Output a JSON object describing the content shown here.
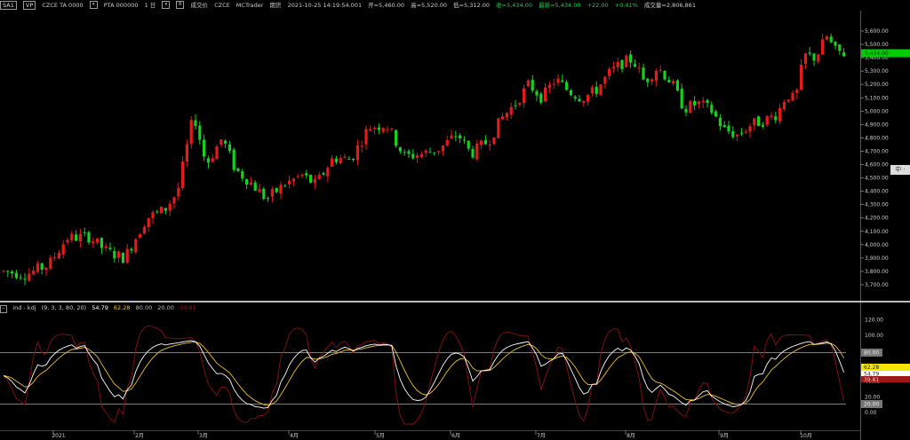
{
  "topbar": {
    "btn1": "SA1",
    "btn2": "VP",
    "symbol": "CZCE TA 0000",
    "symbol2": "PTA 000000",
    "interval": "1 日",
    "source_label": "成交价",
    "exchange": "CZCE",
    "vendor": "MCTrader",
    "kind": "期货",
    "datetime": "2021-10-25  14:19:54.001",
    "open": "开=5,460.00",
    "high": "高=5,520.00",
    "low": "低=5,312.00",
    "close": "收=5,434.00",
    "last": "最新=5,434.00",
    "change": "+22.00",
    "change_pct": "+0.41%",
    "volume": "成交量=2,806,861"
  },
  "indicator_header": {
    "name": "ind - kdj",
    "params": "(9, 3, 3, 80, 20)",
    "k": "54.79",
    "d": "62.28",
    "upper": "80.00",
    "lower": "20.00",
    "j": "39.81"
  },
  "price_axis": {
    "ticks": [
      "5,600.00",
      "5,500.00",
      "5,400.00",
      "5,300.00",
      "5,200.00",
      "5,100.00",
      "5,000.00",
      "4,900.00",
      "4,800.00",
      "4,700.00",
      "4,600.00",
      "4,500.00",
      "4,400.00",
      "4,300.00",
      "4,200.00",
      "4,100.00",
      "4,000.00",
      "3,900.00",
      "3,800.00",
      "3,700.00"
    ],
    "last_label": "5,434.00"
  },
  "ind_axis": {
    "ticks": [
      "120.00",
      "100.00",
      "80.00",
      "60.00",
      "40.00",
      "20.00",
      "0.00"
    ],
    "d_label": "62.28",
    "k_label": "54.79",
    "j_label": "39.81"
  },
  "x_axis": {
    "labels": [
      "2021",
      "2月",
      "3月",
      "4月",
      "5月",
      "6月",
      "7月",
      "8月",
      "9月",
      "10月"
    ]
  },
  "ime": "中 ·",
  "colors": {
    "up": "#e31b1b",
    "down": "#18d11f",
    "k_line": "#ffffff",
    "d_line": "#f0c020",
    "j_line": "#8b1010",
    "last_badge": "#00cc00",
    "d_badge": "#f5e600",
    "j_badge": "#a01515"
  },
  "chart_data": {
    "type": "candlestick",
    "x": [
      "2021",
      "2月",
      "3月",
      "4月",
      "5月",
      "6月",
      "7月",
      "8月",
      "9月",
      "10月"
    ],
    "ylim": [
      3650,
      5700
    ],
    "last": 5434,
    "kdj": {
      "params": [
        9,
        3,
        3
      ],
      "levels": [
        80,
        20
      ],
      "ylim": [
        0,
        125
      ],
      "last": {
        "K": 54.79,
        "D": 62.28,
        "J": 39.81
      }
    }
  }
}
